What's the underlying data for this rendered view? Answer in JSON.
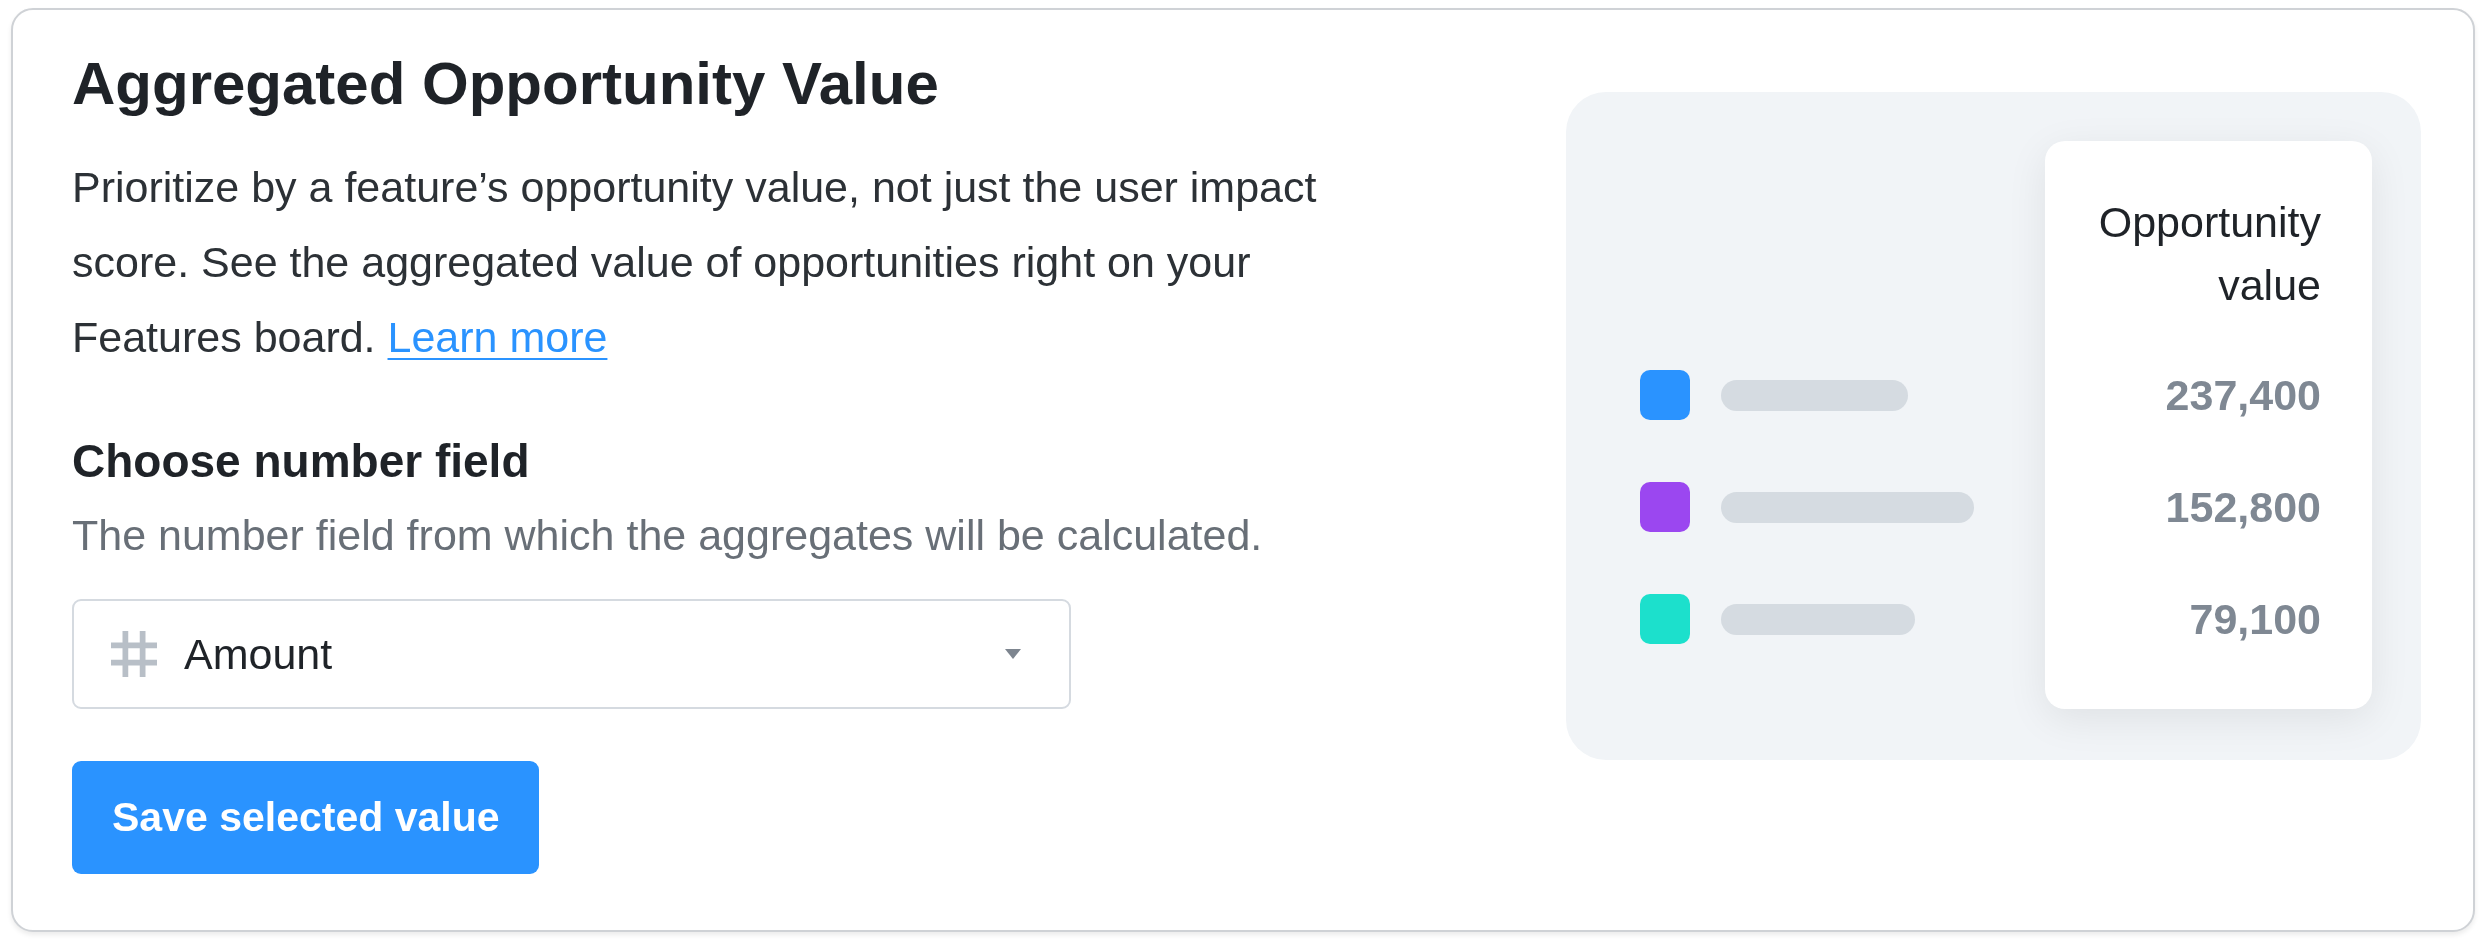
{
  "title": "Aggregated Opportunity Value",
  "description": {
    "text": "Prioritize by a feature’s opportunity value, not just the user impact score. See the aggregated value of opportunities right on your Features board.",
    "link": "Learn more"
  },
  "number_field": {
    "label": "Choose number field",
    "help_text": "The number field from which the aggregates will be calculated.",
    "value": "Amount"
  },
  "save_button": "Save selected value",
  "preview": {
    "column_heading": "Opportunity value",
    "rows": [
      {
        "color": "#2a93ff",
        "value": "237,400"
      },
      {
        "color": "#9b47f0",
        "value": "152,800"
      },
      {
        "color": "#1ce0cc",
        "value": "79,100"
      }
    ]
  }
}
